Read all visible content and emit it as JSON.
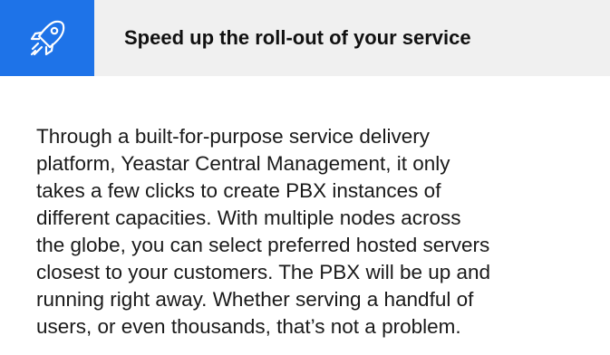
{
  "header": {
    "icon": "rocket-icon",
    "title": "Speed up the roll-out of your service"
  },
  "body": {
    "lines": [
      "Through a built-for-purpose service delivery",
      "platform, Yeastar Central Management, it only",
      "takes a few clicks to create PBX instances of",
      "different capacities. With multiple nodes across",
      "the globe, you can select preferred hosted servers",
      "closest to your customers. The PBX will be up and",
      "running right away. Whether serving a handful of",
      "users, or even thousands, that’s not a problem."
    ]
  },
  "colors": {
    "accent": "#1e73e8",
    "header_background": "#f0f0f0",
    "text": "#1a1a1a"
  }
}
